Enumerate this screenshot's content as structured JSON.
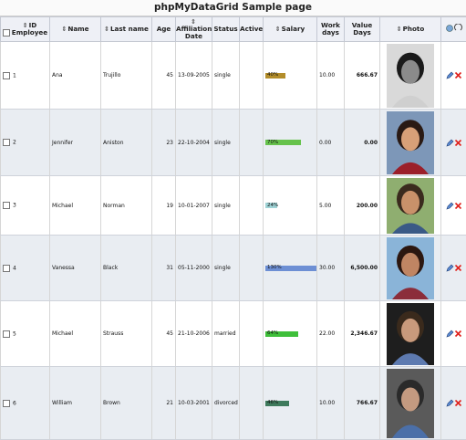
{
  "page": {
    "title": "phpMyDataGrid Sample page"
  },
  "columns": {
    "id": "ID Employee",
    "name": "Name",
    "lastname": "Last name",
    "age": "Age",
    "affiliation": "Affiliation Date",
    "status": "Status",
    "active": "Active",
    "salary": "Salary",
    "workdays": "Work days",
    "value": "Value Days",
    "photo": "Photo"
  },
  "rows": [
    {
      "id": "1",
      "name": "Ana",
      "lastname": "Trujillo",
      "age": "45",
      "date": "13-09-2005",
      "status": "single",
      "salary_pct": 40,
      "salary_label": "40%",
      "salary_color": "#b38d2a",
      "workdays": "10.00",
      "value": "666.67"
    },
    {
      "id": "2",
      "name": "Jennifer",
      "lastname": "Aniston",
      "age": "23",
      "date": "22-10-2004",
      "status": "single",
      "salary_pct": 70,
      "salary_label": "70%",
      "salary_color": "#66c24c",
      "workdays": "0.00",
      "value": "0.00"
    },
    {
      "id": "3",
      "name": "Michael",
      "lastname": "Norman",
      "age": "19",
      "date": "10-01-2007",
      "status": "single",
      "salary_pct": 24,
      "salary_label": "24%",
      "salary_color": "#9fd3d6",
      "workdays": "5.00",
      "value": "200.00"
    },
    {
      "id": "4",
      "name": "Vanessa",
      "lastname": "Black",
      "age": "31",
      "date": "05-11-2000",
      "status": "single",
      "salary_pct": 130,
      "salary_label": "130%",
      "salary_color": "#6d8fd4",
      "workdays": "30.00",
      "value": "6,500.00"
    },
    {
      "id": "5",
      "name": "Michael",
      "lastname": "Strauss",
      "age": "45",
      "date": "21-10-2006",
      "status": "married",
      "salary_pct": 64,
      "salary_label": "64%",
      "salary_color": "#3fbf3a",
      "workdays": "22.00",
      "value": "2,346.67"
    },
    {
      "id": "6",
      "name": "William",
      "lastname": "Brown",
      "age": "21",
      "date": "10-03-2001",
      "status": "divorced",
      "salary_pct": 46,
      "salary_label": "46%",
      "salary_color": "#3e7a5c",
      "workdays": "10.00",
      "value": "766.67"
    }
  ],
  "icons": {
    "edit": "pencil-icon",
    "delete": "delete-x-icon",
    "sort": "sort-arrows-icon"
  },
  "colors": {
    "header_bg": "#eef0f6",
    "alt_row": "#e9edf2",
    "delete": "#e0201b",
    "edit": "#2a5fb0"
  }
}
